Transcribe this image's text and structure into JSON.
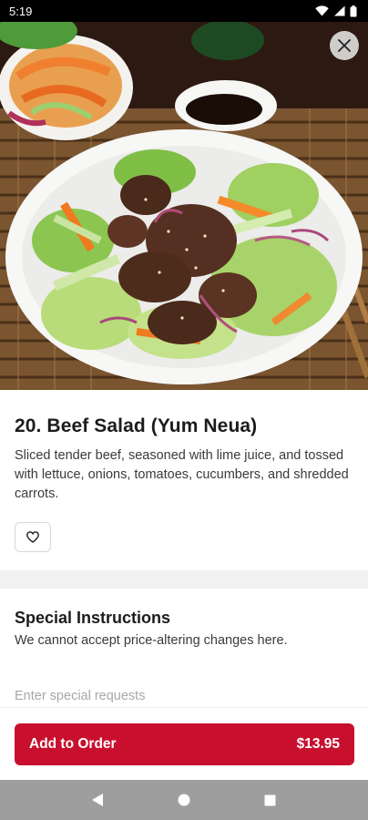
{
  "status_bar": {
    "time": "5:19"
  },
  "item": {
    "title": "20. Beef Salad (Yum Neua)",
    "description": "Sliced tender beef, seasoned with lime juice, and tossed with lettuce, onions, tomatoes, cucumbers, and shredded carrots."
  },
  "special_instructions": {
    "title": "Special Instructions",
    "subtitle": "We cannot accept price-altering changes here.",
    "placeholder": "Enter special requests",
    "value": ""
  },
  "footer": {
    "add_label": "Add to Order",
    "price": "$13.95"
  },
  "colors": {
    "accent": "#c8102e",
    "nav_bar": "#9e9e9e"
  },
  "icons": {
    "close": "close-icon",
    "favorite": "heart-outline-icon",
    "nav_back": "back-triangle-icon",
    "nav_home": "home-circle-icon",
    "nav_recents": "recents-square-icon"
  }
}
